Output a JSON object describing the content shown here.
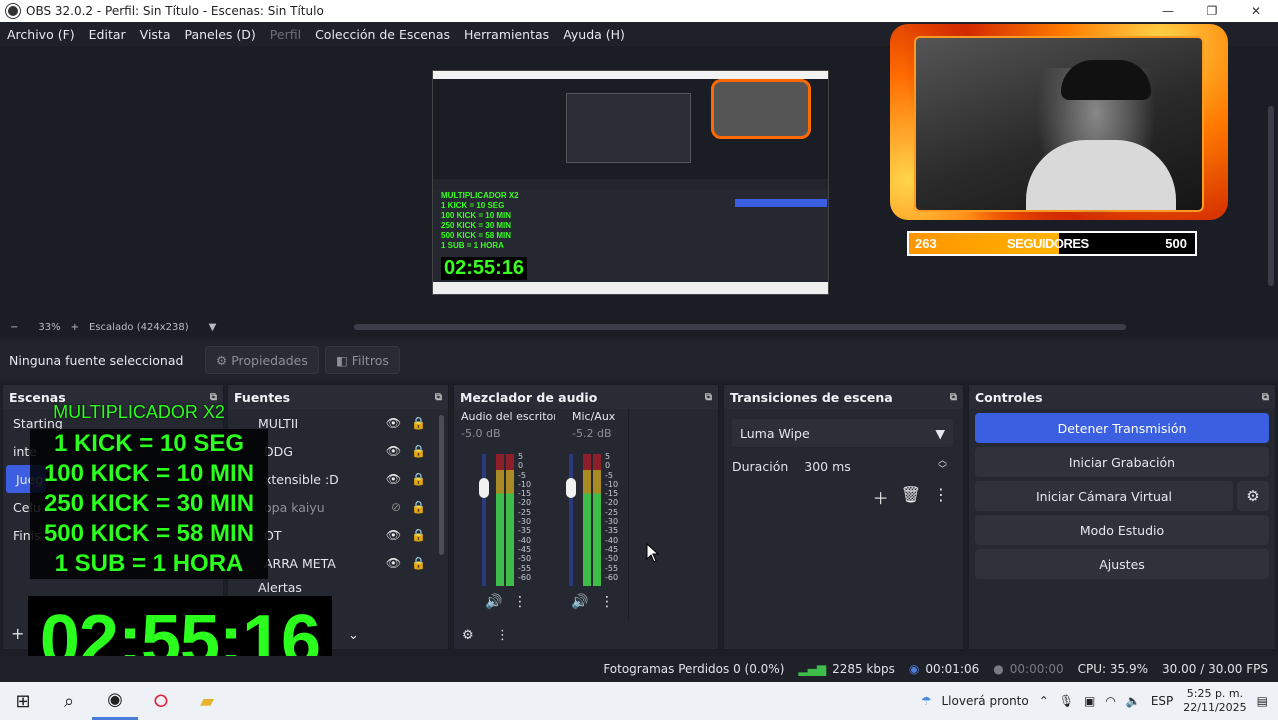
{
  "window": {
    "title": "OBS 32.0.2 - Perfil: Sin Título - Escenas: Sin Título",
    "controls": [
      "—",
      "❐",
      "✕"
    ]
  },
  "menu": {
    "items": [
      "Archivo (F)",
      "Editar",
      "Vista",
      "Paneles (D)",
      "Perfil",
      "Colección de Escenas",
      "Herramientas",
      "Ayuda (H)"
    ]
  },
  "preview": {
    "nested_timer": "02:55:16",
    "nested_green": [
      "MULTIPLICADOR X2",
      "1 KICK = 10 SEG",
      "100 KICK = 10 MIN",
      "250 KICK = 30 MIN",
      "500 KICK = 58 MIN",
      "1 SUB = 1 HORA"
    ],
    "goal": {
      "current": "263",
      "label": "SEGUIDORES",
      "target": "500",
      "progress": 0.526
    },
    "zoom_minus": "−",
    "zoom_level": "33%",
    "zoom_plus": "+",
    "scaling": "Escalado (424x238)"
  },
  "source_toolbar": {
    "no_source": "Ninguna fuente seleccionad",
    "properties": "Propiedades",
    "filters": "Filtros"
  },
  "scenes": {
    "title": "Escenas",
    "items": [
      "Starting",
      "inte",
      "Jueg",
      "Celu",
      "Finis"
    ],
    "active_index": 2,
    "add": "+"
  },
  "sources": {
    "title": "Fuentes",
    "items": [
      {
        "label": "MULTII",
        "dim": false
      },
      {
        "label": "DDG",
        "dim": false
      },
      {
        "label": "xtensible :D",
        "dim": false
      },
      {
        "label": "opa kaiyu",
        "dim": true
      },
      {
        "label": "OT",
        "dim": false
      },
      {
        "label": "ARRA META",
        "dim": false
      },
      {
        "label": "Alertas",
        "dim": false
      }
    ]
  },
  "overlay": {
    "title": "MULTIPLICADOR X2",
    "lines": [
      "1 KICK = 10 SEG",
      "100  KICK = 10 MIN",
      "250 KICK = 30 MIN",
      "500 KICK = 58 MIN",
      "1 SUB = 1 HORA"
    ],
    "timer": "02:55:16"
  },
  "mixer": {
    "title": "Mezclador de audio",
    "channels": [
      {
        "name": "Audio del escritorio",
        "db": "-5.0 dB",
        "level": 0.78
      },
      {
        "name": "Mic/Aux",
        "db": "-5.2 dB",
        "level": 0.78
      }
    ],
    "scale": [
      "5",
      "0",
      "-5",
      "-10",
      "-15",
      "-20",
      "-25",
      "-30",
      "-35",
      "-40",
      "-45",
      "-50",
      "-55",
      "-60"
    ]
  },
  "transitions": {
    "title": "Transiciones de escena",
    "selected": "Luma Wipe",
    "duration_label": "Duración",
    "duration_value": "300 ms"
  },
  "controls": {
    "title": "Controles",
    "stop_stream": "Detener Transmisión",
    "start_recording": "Iniciar Grabación",
    "start_virtual_cam": "Iniciar Cámara Virtual",
    "studio_mode": "Modo Estudio",
    "settings": "Ajustes"
  },
  "status": {
    "dropped_frames": "Fotogramas Perdidos 0 (0.0%)",
    "bitrate": "2285 kbps",
    "stream_time": "00:01:06",
    "record_time": "00:00:00",
    "cpu": "CPU: 35.9%",
    "fps": "30.00 / 30.00 FPS"
  },
  "taskbar": {
    "weather": "Lloverá pronto",
    "language": "ESP",
    "time": "5:25 p. m.",
    "date": "22/11/2025"
  },
  "colors": {
    "accent": "#3a5fe0",
    "overlay_green": "#2bff1d",
    "goal_orange": "#ff9500"
  }
}
